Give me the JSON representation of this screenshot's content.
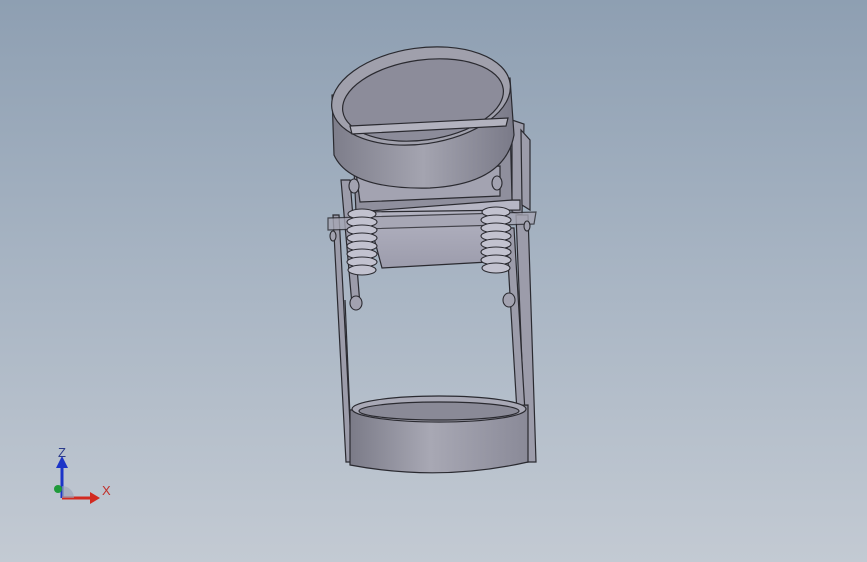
{
  "viewport": {
    "background_top": "#8e9fb2",
    "background_bottom": "#c3cad3"
  },
  "model": {
    "part_color": "#9a9aa6",
    "edge_color": "#2a2a30",
    "spring_color": "#b8b8c4"
  },
  "triad": {
    "z_label": "Z",
    "x_label": "X",
    "z_color": "#1c34c8",
    "x_color": "#d22a20",
    "y_color": "#1f9a3a"
  }
}
